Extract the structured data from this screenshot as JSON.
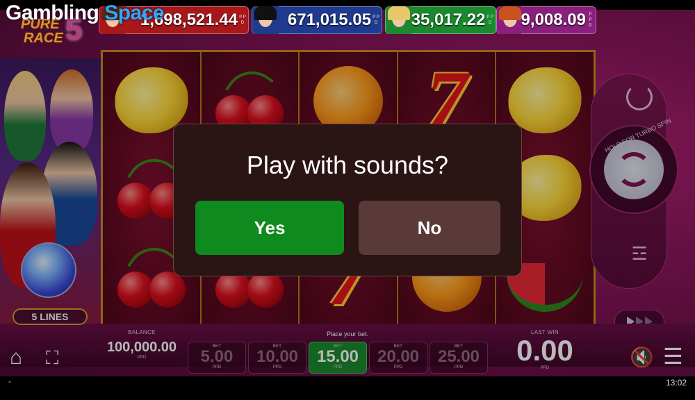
{
  "watermark": {
    "part1": "Gambling",
    "part2": "Space"
  },
  "game_logo": {
    "line1": "PURE",
    "line2": "RACE",
    "number": "5"
  },
  "jackpots": [
    {
      "amount": "1,698,521.44",
      "unit": "P P D",
      "color": "#a8171a",
      "hair": "#5a2a10"
    },
    {
      "amount": "671,015.05",
      "unit": "P P D",
      "color": "#1f3a8e",
      "hair": "#111"
    },
    {
      "amount": "35,017.22",
      "unit": "P P D",
      "color": "#1b8a2e",
      "hair": "#e8c66a"
    },
    {
      "amount": "9,008.09",
      "unit": "P P D",
      "color": "#8a1f7e",
      "hair": "#c9531e"
    }
  ],
  "lines_badge": "5 LINES",
  "reels": [
    [
      "lemon",
      "cherry",
      "cherry"
    ],
    [
      "cherry",
      "cherry",
      "cherry"
    ],
    [
      "orange",
      "orange",
      "seven"
    ],
    [
      "seven",
      "seven",
      "orange"
    ],
    [
      "lemon",
      "lemon",
      "watermelon"
    ]
  ],
  "controls": {
    "turbo_hint": "HOLD FOR TURBO SPIN"
  },
  "balance": {
    "label": "BALANCE",
    "value": "100,000.00",
    "unit": "PPD"
  },
  "prompt": "Place your bet.",
  "bets": [
    {
      "label": "BET",
      "value": "5.00",
      "unit": "PPD",
      "selected": false
    },
    {
      "label": "BET",
      "value": "10.00",
      "unit": "PPD",
      "selected": false
    },
    {
      "label": "BET",
      "value": "15.00",
      "unit": "PPD",
      "selected": true
    },
    {
      "label": "BET",
      "value": "20.00",
      "unit": "PPD",
      "selected": false
    },
    {
      "label": "BET",
      "value": "25.00",
      "unit": "PPD",
      "selected": false
    }
  ],
  "last_win": {
    "label": "LAST WIN",
    "value": "0.00",
    "unit": "PPD"
  },
  "dialog": {
    "question": "Play with sounds?",
    "yes_label": "Yes",
    "no_label": "No"
  },
  "status_bar": {
    "left": "-",
    "time": "13:02"
  }
}
